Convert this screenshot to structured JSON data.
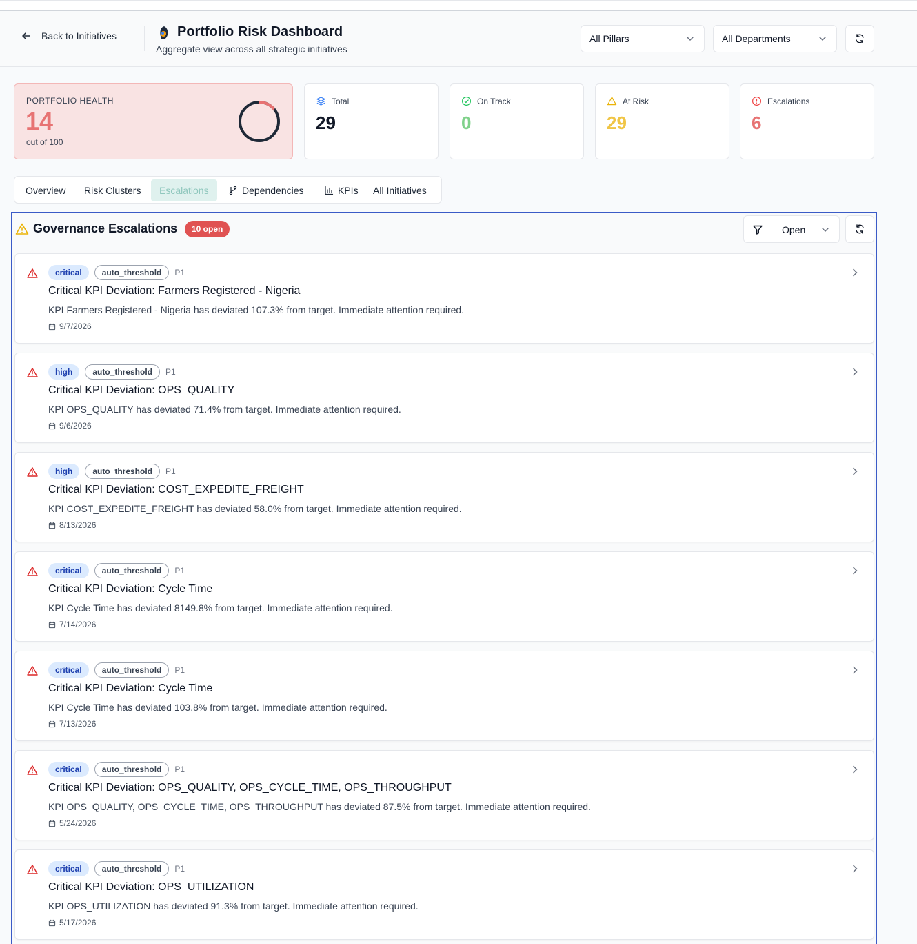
{
  "header": {
    "back_label": "Back to Initiatives",
    "title": "Portfolio Risk Dashboard",
    "subtitle": "Aggregate view across all strategic initiatives",
    "pillar_select": "All Pillars",
    "department_select": "All Departments"
  },
  "health": {
    "label": "PORTFOLIO HEALTH",
    "score": "14",
    "out_of": "out of 100",
    "ring_fraction": 0.14,
    "color": "#e77373"
  },
  "stats": {
    "total": {
      "label": "Total",
      "value": "29",
      "color": "#111827"
    },
    "on_track": {
      "label": "On Track",
      "value": "0",
      "color": "#7fd18a"
    },
    "at_risk": {
      "label": "At Risk",
      "value": "29",
      "color": "#f0c545"
    },
    "escalations": {
      "label": "Escalations",
      "value": "6",
      "color": "#e77373"
    }
  },
  "tabs": [
    "Overview",
    "Risk Clusters",
    "Escalations",
    "Dependencies",
    "KPIs",
    "All Initiatives"
  ],
  "active_tab": "Escalations",
  "panel": {
    "title": "Governance Escalations",
    "badge": "10 open",
    "filter_value": "Open"
  },
  "escalations": [
    {
      "severity": "critical",
      "source": "auto_threshold",
      "priority": "P1",
      "title": "Critical KPI Deviation: Farmers Registered - Nigeria",
      "description": "KPI Farmers Registered - Nigeria has deviated 107.3% from target. Immediate attention required.",
      "date": "9/7/2026"
    },
    {
      "severity": "high",
      "source": "auto_threshold",
      "priority": "P1",
      "title": "Critical KPI Deviation: OPS_QUALITY",
      "description": "KPI OPS_QUALITY has deviated 71.4% from target. Immediate attention required.",
      "date": "9/6/2026"
    },
    {
      "severity": "high",
      "source": "auto_threshold",
      "priority": "P1",
      "title": "Critical KPI Deviation: COST_EXPEDITE_FREIGHT",
      "description": "KPI COST_EXPEDITE_FREIGHT has deviated 58.0% from target. Immediate attention required.",
      "date": "8/13/2026"
    },
    {
      "severity": "critical",
      "source": "auto_threshold",
      "priority": "P1",
      "title": "Critical KPI Deviation: Cycle Time",
      "description": "KPI Cycle Time has deviated 8149.8% from target. Immediate attention required.",
      "date": "7/14/2026"
    },
    {
      "severity": "critical",
      "source": "auto_threshold",
      "priority": "P1",
      "title": "Critical KPI Deviation: Cycle Time",
      "description": "KPI Cycle Time has deviated 103.8% from target. Immediate attention required.",
      "date": "7/13/2026"
    },
    {
      "severity": "critical",
      "source": "auto_threshold",
      "priority": "P1",
      "title": "Critical KPI Deviation: OPS_QUALITY, OPS_CYCLE_TIME, OPS_THROUGHPUT",
      "description": "KPI OPS_QUALITY, OPS_CYCLE_TIME, OPS_THROUGHPUT has deviated 87.5% from target. Immediate attention required.",
      "date": "5/24/2026"
    },
    {
      "severity": "critical",
      "source": "auto_threshold",
      "priority": "P1",
      "title": "Critical KPI Deviation: OPS_UTILIZATION",
      "description": "KPI OPS_UTILIZATION has deviated 91.3% from target. Immediate attention required.",
      "date": "5/17/2026"
    }
  ]
}
